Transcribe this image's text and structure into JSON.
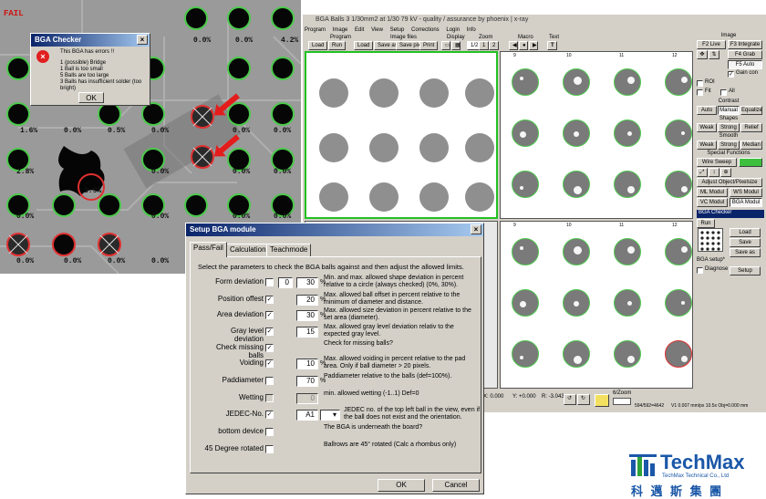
{
  "watermark": "TechMax Technical",
  "xray": {
    "fail_label": "FAIL",
    "values": [
      "0.0%",
      "0.0%",
      "4.2%",
      "1.6%",
      "0.0%",
      "0.5%",
      "0.0%",
      "0.0%",
      "0.0%",
      "2.8%",
      "3.9%",
      "0.0%",
      "0.0%",
      "0.0%",
      "0.0%",
      "0.0%",
      "0.0%",
      "0.0%",
      "0.0%",
      "0.0%",
      "0.0%",
      "0.0%",
      "0.0%",
      "0.4%",
      "0.0%"
    ]
  },
  "error_dialog": {
    "title": "BGA Checker",
    "heading": "This BGA has errors !!",
    "lines": [
      "1 (possible) Bridge",
      "1 Ball is too small",
      "5 Balls are too large",
      "3 Balls has insufficient solder (too bright)"
    ],
    "ok": "OK"
  },
  "app": {
    "title": "BGA Balls 3  1/30mm2 at 1/30  79 kV - quality / assurance by phoenix | x-ray",
    "menu": [
      "Program",
      "Image",
      "Edit",
      "View",
      "Setup",
      "Corrections",
      "Login",
      "Info"
    ],
    "groups": {
      "program": "Program",
      "image_files": "Image files",
      "display": "Display",
      "zoom": "Zoom",
      "macro": "Macro",
      "text": "Text"
    },
    "toolbar": [
      "Load",
      "Run",
      "Load",
      "Save as",
      "Save pixel",
      "Print"
    ],
    "zoom_value": "1/2",
    "zoom_steps": [
      "1",
      "2"
    ],
    "panel_cols_top": [
      "9",
      "10",
      "11",
      "12"
    ],
    "panel_cols_bottom": [
      "9",
      "10",
      "11",
      "12"
    ],
    "status": {
      "x": "0.000",
      "y": "+0.000",
      "r": "-3.043",
      "zoom_label": "6/Zoom",
      "coords": "594/592=4642",
      "version": "V1   0.007 mm/px  10.5x   Obj=0.000 mm"
    }
  },
  "controls": {
    "image": "Image",
    "f2": "F2  Live",
    "f3": "F3 Integrate",
    "f4": "F4  Grab",
    "f5": "F5 Auto",
    "gain": "Gain con",
    "roi": "ROI",
    "fit": "Fit",
    "all": "All",
    "contrast": "Contrast",
    "contrast_btns": [
      "Auto",
      "Manual",
      "Equalize"
    ],
    "shapes": "Shapes",
    "shapes_btns": [
      "Weak",
      "Strong",
      "Relief"
    ],
    "smooth": "Smooth",
    "smooth_btns": [
      "Weak",
      "Strong",
      "Median"
    ],
    "special": "Special Functions",
    "wire_sweep": "Wire Sweep",
    "adjust": "Adjust Object/Pixelsize",
    "ml_modul": "ML Modul",
    "ws_modul": "WS Modul",
    "vc_modul": "VC Modul",
    "bga_modul": "BGA Modul",
    "bga_title": "BGA Checker",
    "run": "Run",
    "load": "Load",
    "save": "Save",
    "save_as": "Save as",
    "bga_setup": "BGA setup*",
    "diagnose": "Diagnose",
    "setup": "Setup"
  },
  "setup_dialog": {
    "title": "Setup BGA module",
    "tabs": [
      "Pass/Fail",
      "Calculation",
      "Teachmode"
    ],
    "intro": "Select the parameters to check the BGA balls against and then adjust the allowed limits.",
    "rows": [
      {
        "label": "Form deviation",
        "checked": false,
        "value": "30",
        "min": "0",
        "unit": "%",
        "desc": "Min. and max. allowed shape deviation in percent relative to a circle (always checked) (0%, 30%)."
      },
      {
        "label": "Position offest",
        "checked": true,
        "value": "20",
        "unit": "%",
        "desc": "Max. allowed ball offset in percent relative to the minimum of diameter and distance."
      },
      {
        "label": "Area deviation",
        "checked": true,
        "value": "30",
        "unit": "%",
        "desc": "Max. allowed size deviation in percent relative to the set area (diameter)."
      },
      {
        "label": "Gray level deviation",
        "checked": true,
        "value": "15",
        "unit": "",
        "desc": "Max. allowed gray level deviation relativ to the expected gray level."
      },
      {
        "label": "Check missing balls",
        "checked": true,
        "value": "",
        "unit": "",
        "desc": "Check for missing balls?"
      },
      {
        "label": "Voiding",
        "checked": true,
        "value": "10",
        "unit": "%",
        "desc": "Max. allowed voiding in percent relative to the pad area. Only if ball diameter > 20 pixels."
      },
      {
        "label": "Paddiameter",
        "checked": false,
        "value": "70",
        "unit": "%",
        "desc": "Paddiameter relative to the balls (def=100%)."
      },
      {
        "label": "Wetting",
        "checked": false,
        "value": "0",
        "unit": "",
        "desc": "min. allowed wetting (-1..1) Def=0"
      },
      {
        "label": "JEDEC-No.",
        "checked": true,
        "value": "A1",
        "unit": "",
        "desc": "JEDEC no. of the top left ball in the view, even if the ball does not exist and the orientation."
      },
      {
        "label": "bottom device",
        "checked": false,
        "value": "",
        "unit": "",
        "desc": "The BGA is underneath the board?"
      },
      {
        "label": "45 Degree rotated",
        "checked": false,
        "value": "",
        "unit": "",
        "desc": "Ballrows are 45° rotated (Calc a rhombus only)"
      }
    ],
    "ok": "OK",
    "cancel": "Cancel"
  },
  "logo": {
    "brand": "TechMax",
    "sub": "TechMax Technical Co., Ltd",
    "chinese": "科 邁 斯 集 團",
    "brand_color": "#1a57a8",
    "green": "#2fa23a"
  }
}
